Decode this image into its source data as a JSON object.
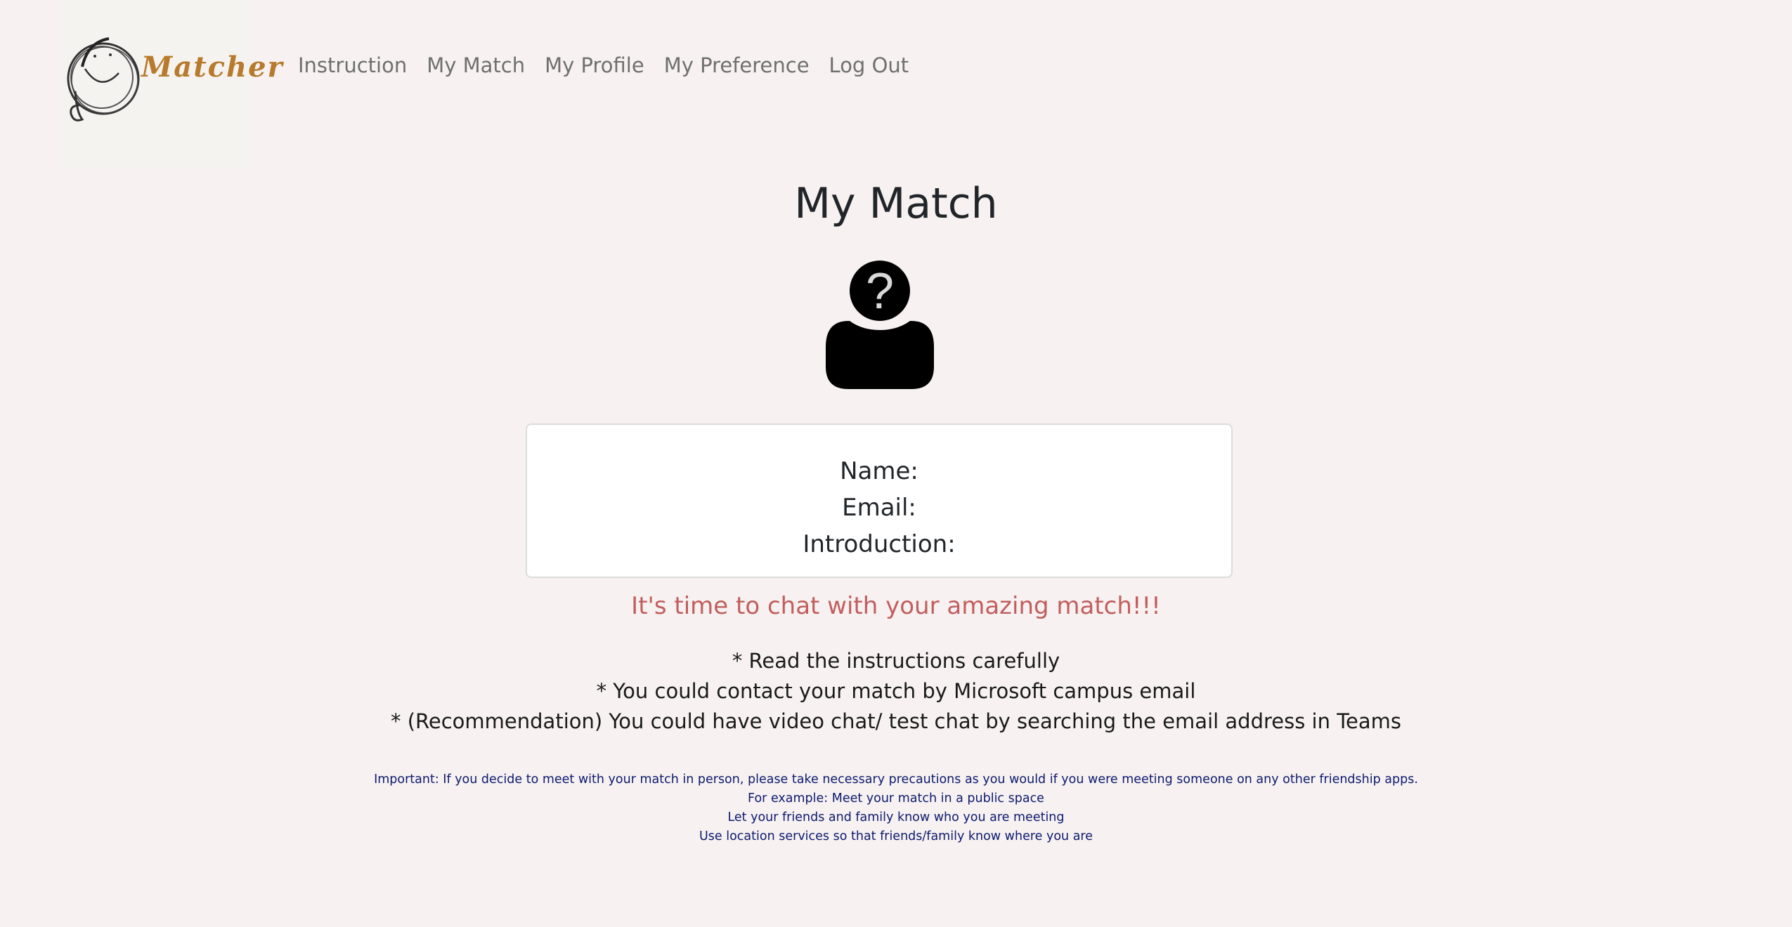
{
  "brand": {
    "name": "Matcher",
    "accent_color": "#b87a2c"
  },
  "nav": {
    "items": [
      {
        "label": "Instruction"
      },
      {
        "label": "My Match"
      },
      {
        "label": "My Profile"
      },
      {
        "label": "My Preference"
      },
      {
        "label": "Log Out"
      }
    ]
  },
  "main": {
    "title": "My Match",
    "avatar_icon": "unknown-person-icon",
    "avatar_glyph": "?",
    "card": {
      "name_label": "Name:",
      "email_label": "Email:",
      "intro_label": "Introduction:"
    },
    "cta": "It's time to chat with your amazing match!!!",
    "tips": [
      "* Read the instructions carefully",
      "* You could contact your match by Microsoft campus email",
      "* (Recommendation) You could have video chat/ test chat by searching the email address in Teams"
    ],
    "important": [
      "Important: If you decide to meet with your match in person, please take necessary precautions as you would if you were meeting someone on any other friendship apps.",
      "For example: Meet your match in a public space",
      "Let your friends and family know who you are meeting",
      "Use location services so that friends/family know where you are"
    ]
  },
  "colors": {
    "background": "#f7f1f1",
    "cta": "#c25e5e",
    "important_text": "#0d1a6e",
    "nav_text": "#6f6f6f"
  }
}
